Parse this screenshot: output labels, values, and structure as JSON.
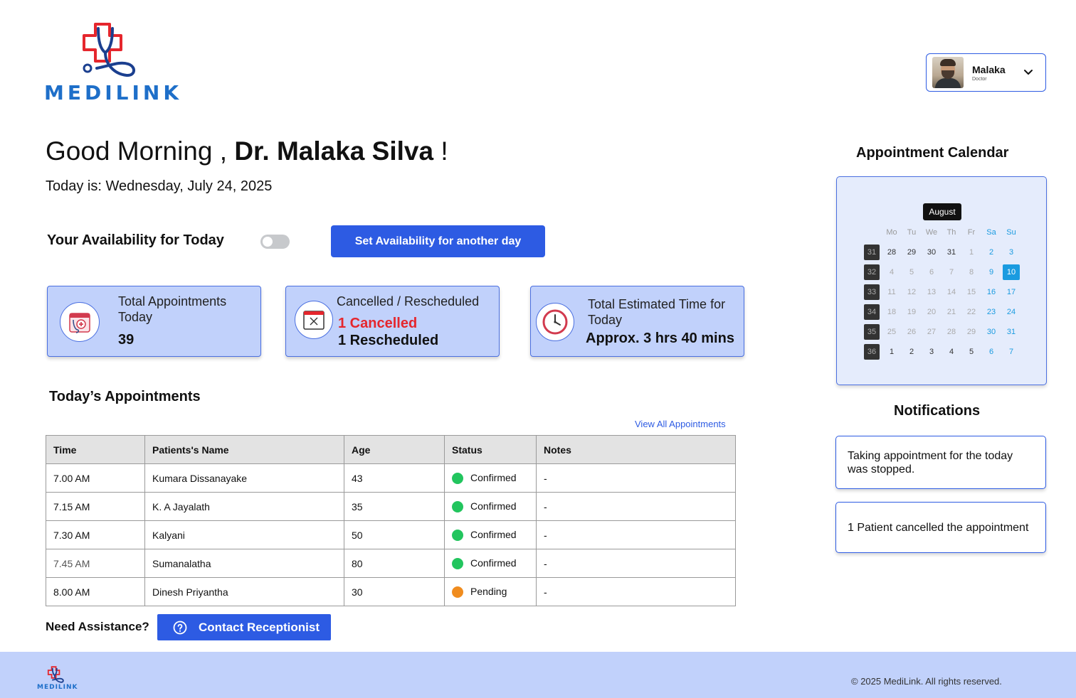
{
  "brand": {
    "name": "MEDILINK",
    "accent": "#2d5be3",
    "logo_blue": "#1e6fc9",
    "logo_red": "#e5262d"
  },
  "user": {
    "name": "Malaka",
    "role": "Doctor"
  },
  "greeting": {
    "prefix": "Good Morning ,",
    "name": "Dr. Malaka Silva",
    "suffix": "!"
  },
  "today": "Today is: Wednesday, July 24, 2025",
  "availability": {
    "label": "Your Availability for Today",
    "enabled": false,
    "set_button": "Set Availability for another day"
  },
  "stats": {
    "total": {
      "title": "Total Appointments Today",
      "value": "39"
    },
    "cancelled": {
      "title": "Cancelled / Rescheduled",
      "cancelled": "1 Cancelled",
      "rescheduled": "1 Rescheduled"
    },
    "time": {
      "title": "Total Estimated Time for Today",
      "value": "Approx. 3 hrs 40 mins"
    }
  },
  "appointments": {
    "title": "Today’s Appointments",
    "view_all": "View All Appointments",
    "columns": [
      "Time",
      "Patients's Name",
      "Age",
      "Status",
      "Notes"
    ],
    "rows": [
      {
        "time": "7.00 AM",
        "name": "Kumara Dissanayake",
        "age": "43",
        "status": "Confirmed",
        "status_color": "#22c55e",
        "notes": "-"
      },
      {
        "time": "7.15 AM",
        "name": "K. A Jayalath",
        "age": "35",
        "status": "Confirmed",
        "status_color": "#22c55e",
        "notes": "-"
      },
      {
        "time": "7.30 AM",
        "name": "Kalyani",
        "age": "50",
        "status": "Confirmed",
        "status_color": "#22c55e",
        "notes": "-"
      },
      {
        "time": "7.45 AM",
        "name": "Sumanalatha",
        "age": "80",
        "status": "Confirmed",
        "status_color": "#22c55e",
        "notes": "-"
      },
      {
        "time": "8.00 AM",
        "name": "Dinesh Priyantha",
        "age": "30",
        "status": "Pending",
        "status_color": "#f08c1e",
        "notes": "-"
      }
    ]
  },
  "assistance": {
    "label": "Need Assistance?",
    "button": "Contact Receptionist"
  },
  "calendar": {
    "title": "Appointment Calendar",
    "month": "August",
    "weekdays": [
      "Mo",
      "Tu",
      "We",
      "Th",
      "Fr",
      "Sa",
      "Su"
    ],
    "weeks": [
      {
        "week": "31",
        "days": [
          "28",
          "29",
          "30",
          "31",
          "1",
          "2",
          "3"
        ]
      },
      {
        "week": "32",
        "days": [
          "4",
          "5",
          "6",
          "7",
          "8",
          "9",
          "10"
        ]
      },
      {
        "week": "33",
        "days": [
          "11",
          "12",
          "13",
          "14",
          "15",
          "16",
          "17"
        ]
      },
      {
        "week": "34",
        "days": [
          "18",
          "19",
          "20",
          "21",
          "22",
          "23",
          "24"
        ]
      },
      {
        "week": "35",
        "days": [
          "25",
          "26",
          "27",
          "28",
          "29",
          "30",
          "31"
        ]
      },
      {
        "week": "36",
        "days": [
          "1",
          "2",
          "3",
          "4",
          "5",
          "6",
          "7"
        ]
      }
    ],
    "selected": "10"
  },
  "notifications": {
    "title": "Notifications",
    "items": [
      "Taking appointment for the today was stopped.",
      "1 Patient cancelled the appointment"
    ]
  },
  "footer": {
    "copyright": "© 2025 MediLink. All rights reserved."
  }
}
